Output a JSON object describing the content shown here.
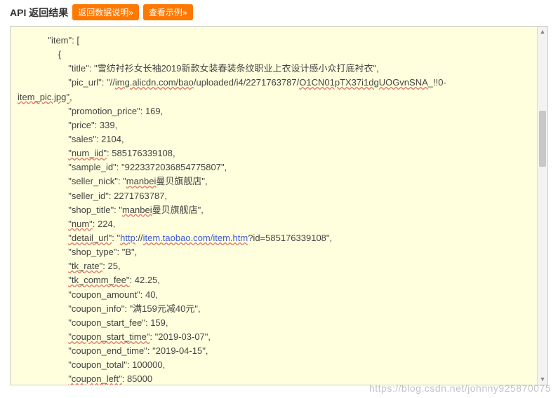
{
  "header": {
    "title": "API 返回结果",
    "btn_explain": "返回数据说明»",
    "btn_example": "查看示例»"
  },
  "code": {
    "indent0": "            \"item\": [",
    "indent1": "                {",
    "pad": "                    ",
    "pad_left": "",
    "title_k": "\"title\"",
    "title_v": "\"雪纺衬衫女长袖2019新款女装春装条纹职业上衣设计感小众打底衬衣\"",
    "pic_k": "\"pic_url\"",
    "pic_p1": "\"//",
    "pic_u1": "img.alicdn.com/bao",
    "pic_p2": "/uploaded/i4/2271763787/",
    "pic_u2": "O1CN01pTX37i1dgUOGvnSNA",
    "pic_p3": "_!!0-",
    "pic_line2": "item_pic.jpg\",",
    "promo_k": "\"promotion_price\"",
    "promo_v": "169",
    "price_k": "\"price\"",
    "price_v": "339",
    "sales_k": "\"sales\"",
    "sales_v": "2104",
    "numiid_k": "\"num_iid\"",
    "numiid_v": "585176339108",
    "sample_k": "\"sample_id\"",
    "sample_v": "\"9223372036854775807\"",
    "nick_k": "\"seller_nick\"",
    "nick_p1": "\"",
    "nick_u": "manbei",
    "nick_p2": "曼贝旗舰店\"",
    "sellerid_k": "\"seller_id\"",
    "sellerid_v": "2271763787",
    "shop_k": "\"shop_title\"",
    "shop_p1": "\"",
    "shop_u": "manbei",
    "shop_p2": "曼贝旗舰店\"",
    "num_k": "\"num\"",
    "num_v": "224",
    "detail_k": "\"detail_url\"",
    "detail_p1": "\"",
    "detail_l1": "http",
    "detail_p2": "://",
    "detail_l2": "item.taobao.com/item.htm",
    "detail_p3": "?id=585176339108\"",
    "stype_k": "\"shop_type\"",
    "stype_v": "\"B\"",
    "tkrate_k": "\"tk_rate\"",
    "tkrate_v": "25",
    "tkfee_k": "\"tk_comm_fee\"",
    "tkfee_v": "42.25",
    "cpa_k": "\"coupon_amount\"",
    "cpa_v": "40",
    "cpi_k": "\"coupon_info\"",
    "cpi_v": "\"满159元减40元\"",
    "cpsf_k": "\"coupon_start_fee\"",
    "cpsf_v": "159",
    "cpst_k": "\"coupon_start_time\"",
    "cpst_v": "\"2019-03-07\"",
    "cpet_k": "\"coupon_end_time\"",
    "cpet_v": "\"2019-04-15\"",
    "cpt_k": "\"coupon_total\"",
    "cpt_v": "100000",
    "cpl_k": "\"coupon_left\"",
    "cpl_v": "85000"
  },
  "watermark": "https://blog.csdn.net/johnny925870075"
}
